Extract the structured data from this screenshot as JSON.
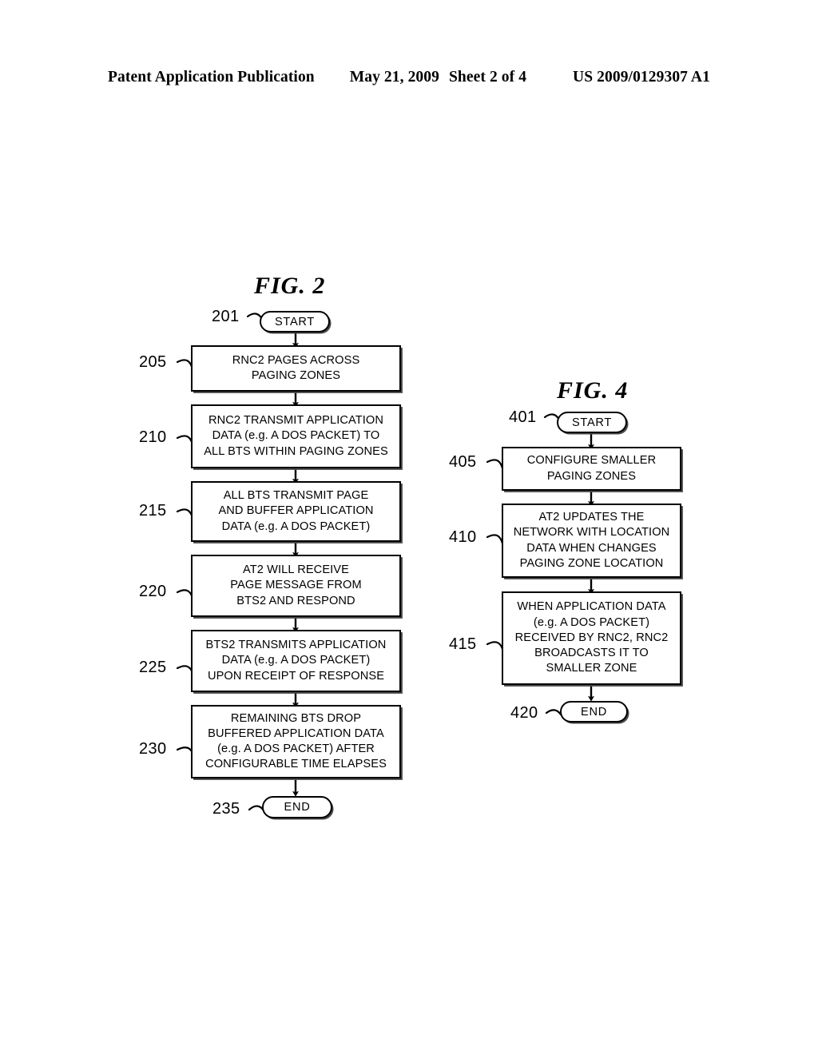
{
  "header": {
    "publication": "Patent Application Publication",
    "date": "May 21, 2009",
    "sheet": "Sheet 2 of 4",
    "patent_number": "US 2009/0129307 A1"
  },
  "figures": [
    {
      "id": "fig2",
      "title": "FIG. 2",
      "nodes": [
        {
          "ref": "201",
          "type": "terminator",
          "label": "START"
        },
        {
          "ref": "205",
          "type": "process",
          "label": "RNC2 PAGES ACROSS\nPAGING ZONES"
        },
        {
          "ref": "210",
          "type": "process",
          "label": "RNC2 TRANSMIT APPLICATION\nDATA (e.g. A DOS PACKET) TO\nALL BTS WITHIN PAGING ZONES"
        },
        {
          "ref": "215",
          "type": "process",
          "label": "ALL BTS TRANSMIT PAGE\nAND BUFFER APPLICATION\nDATA (e.g. A DOS PACKET)"
        },
        {
          "ref": "220",
          "type": "process",
          "label": "AT2 WILL RECEIVE\nPAGE MESSAGE FROM\nBTS2 AND RESPOND"
        },
        {
          "ref": "225",
          "type": "process",
          "label": "BTS2 TRANSMITS APPLICATION\nDATA (e.g. A DOS PACKET)\nUPON RECEIPT OF RESPONSE"
        },
        {
          "ref": "230",
          "type": "process",
          "label": "REMAINING BTS DROP\nBUFFERED APPLICATION DATA\n(e.g. A DOS PACKET) AFTER\nCONFIGURABLE TIME ELAPSES"
        },
        {
          "ref": "235",
          "type": "terminator",
          "label": "END"
        }
      ]
    },
    {
      "id": "fig4",
      "title": "FIG. 4",
      "nodes": [
        {
          "ref": "401",
          "type": "terminator",
          "label": "START"
        },
        {
          "ref": "405",
          "type": "process",
          "label": "CONFIGURE SMALLER\nPAGING ZONES"
        },
        {
          "ref": "410",
          "type": "process",
          "label": "AT2 UPDATES THE\nNETWORK WITH LOCATION\nDATA WHEN CHANGES\nPAGING ZONE LOCATION"
        },
        {
          "ref": "415",
          "type": "process",
          "label": "WHEN APPLICATION DATA\n(e.g. A DOS PACKET)\nRECEIVED BY RNC2, RNC2\nBROADCASTS IT TO\nSMALLER ZONE"
        },
        {
          "ref": "420",
          "type": "terminator",
          "label": "END"
        }
      ]
    }
  ],
  "colors": {
    "ink": "#000000",
    "paper": "#ffffff"
  }
}
